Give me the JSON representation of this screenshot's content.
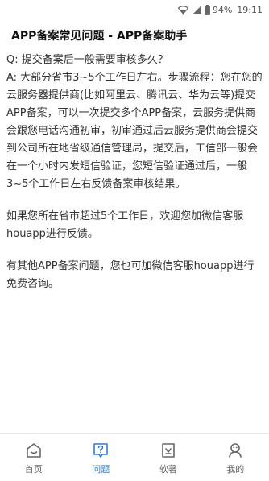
{
  "status_bar": {
    "battery": "94%",
    "time": "19:11"
  },
  "header": {
    "title": "APP备案常见问题 - APP备案助手"
  },
  "article": {
    "question": "Q: 提交备案后一般需要审核多久？",
    "answer": "A: 大部分省市3~5个工作日左右。步骤流程：您在您的云服务器提供商(比如阿里云、腾讯云、华为云等)提交APP备案，可以一次提交多个APP备案，云服务提供商会跟您电话沟通初审，初审通过后云服务提供商会提交到公司所在地省级通信管理局，提交后，工信部一般会在一个小时内发短信验证，您短信验证通过后，一般3~5个工作日左右反馈备案审核结果。",
    "para2": "如果您所在省市超过5个工作日，欢迎您加微信客服houapp进行反馈。",
    "para3": "有其他APP备案问题，您也可加微信客服houapp进行免费咨询。"
  },
  "tabs": [
    {
      "label": "首页",
      "icon": "home-icon",
      "active": false
    },
    {
      "label": "问题",
      "icon": "question-icon",
      "active": true
    },
    {
      "label": "软著",
      "icon": "certificate-icon",
      "active": false
    },
    {
      "label": "我的",
      "icon": "profile-icon",
      "active": false
    }
  ],
  "colors": {
    "accent": "#2f7dd6",
    "text": "#333333",
    "tab_inactive": "#666666"
  }
}
